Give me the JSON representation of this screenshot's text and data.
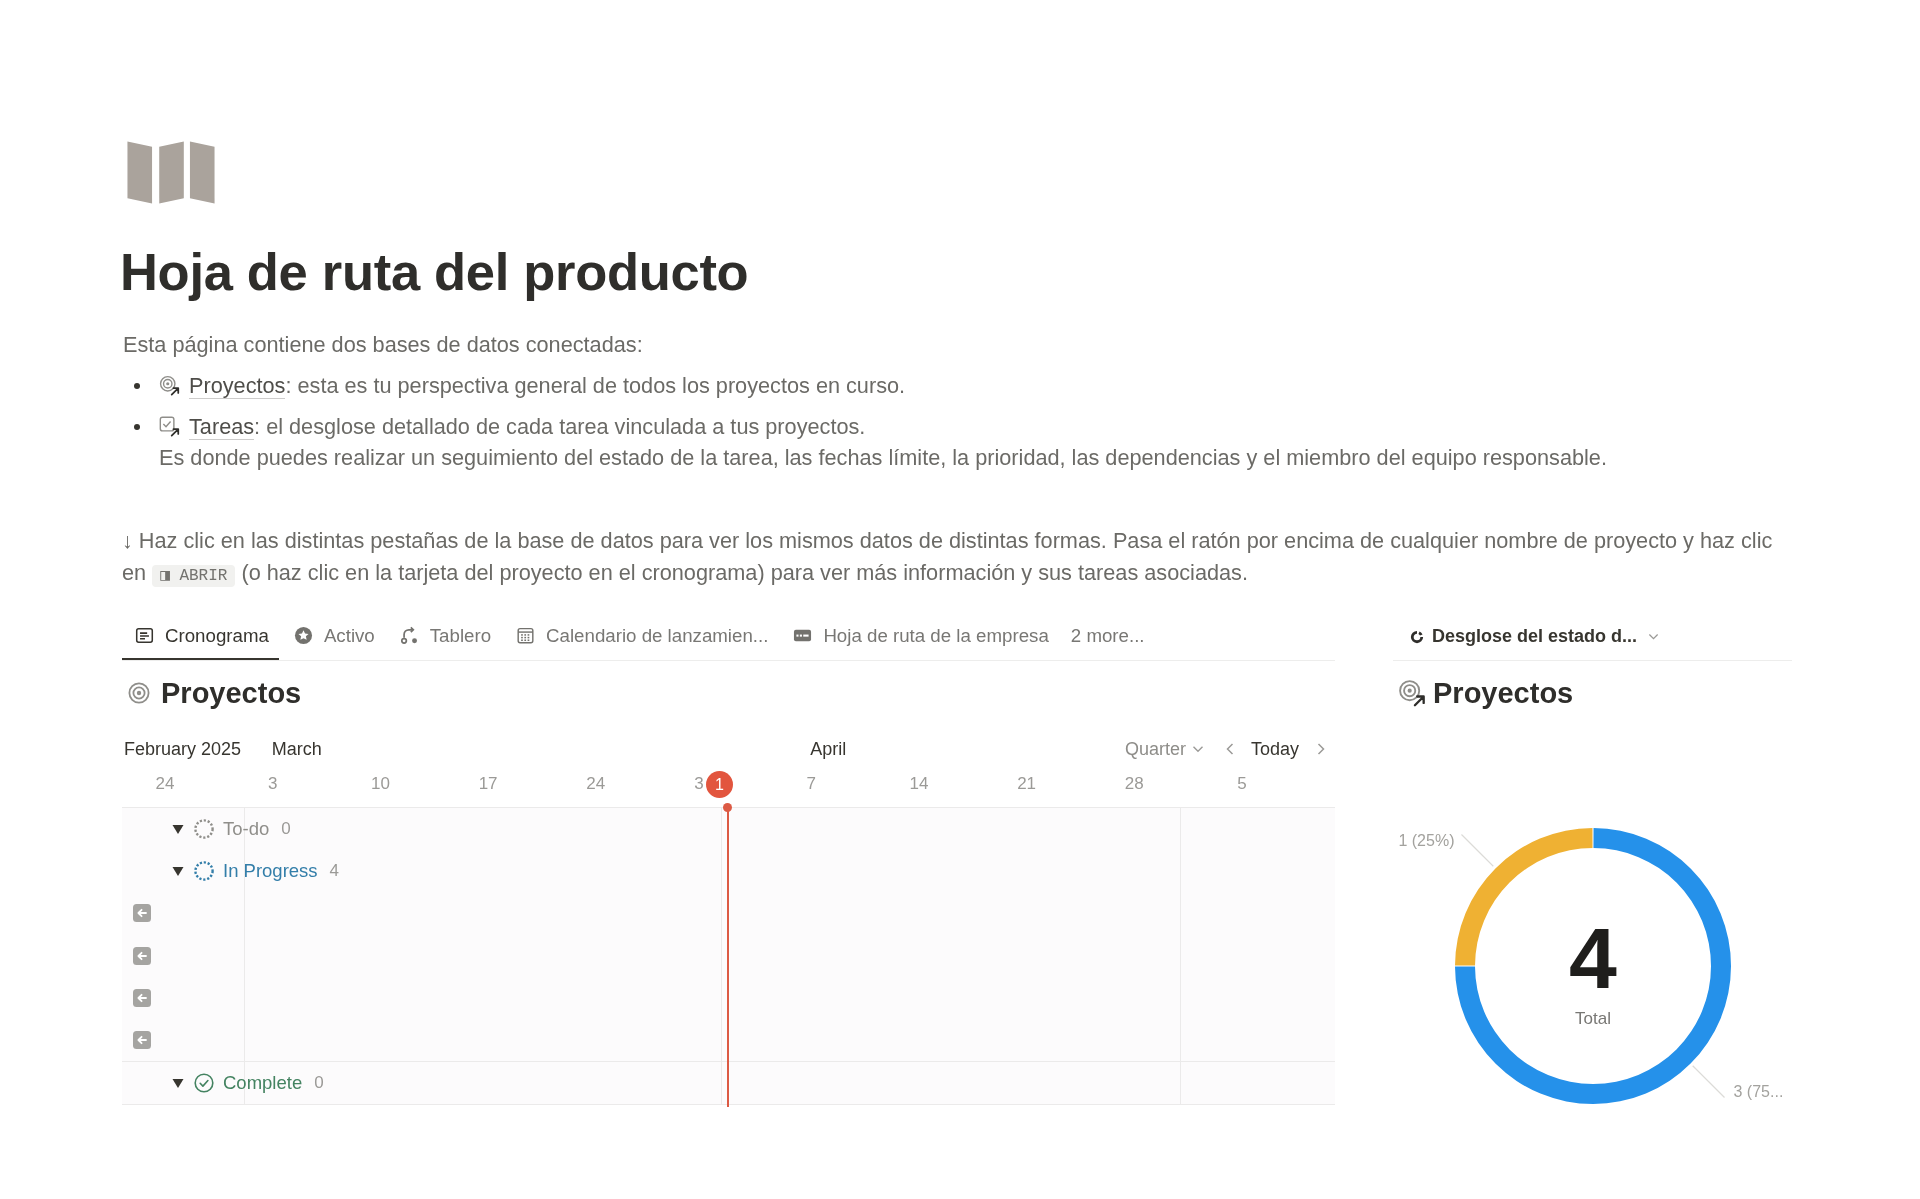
{
  "page": {
    "title": "Hoja de ruta del producto",
    "intro": "Esta página contiene dos bases de datos conectadas:",
    "bullets": [
      {
        "kind": "projects",
        "link": "Proyectos",
        "text": ": esta es tu perspectiva general de todos los proyectos en curso."
      },
      {
        "kind": "tasks",
        "link": "Tareas",
        "text": ": el desglose detallado de cada tarea vinculada a tus proyectos.",
        "continuation": "Es donde puedes realizar un seguimiento del estado de la tarea, las fechas límite, la prioridad, las dependencias y el miembro del equipo responsable."
      }
    ],
    "instruction": {
      "before": "↓ Haz clic en las distintas pestañas de la base de datos para ver los mismos datos de distintas formas. Pasa el ratón por encima de cualquier nombre de proyecto y haz clic en",
      "code": "◨ ABRIR",
      "after": "(o haz clic en la tarjeta del proyecto en el cronograma) para ver más información y sus tareas asociadas."
    }
  },
  "views": {
    "tabs": [
      {
        "label": "Cronograma",
        "kind": "timeline",
        "selected": true
      },
      {
        "label": "Activo",
        "kind": "star",
        "selected": false
      },
      {
        "label": "Tablero",
        "kind": "board",
        "selected": false
      },
      {
        "label": "Calendario de lanzamien...",
        "kind": "calendar",
        "selected": false
      },
      {
        "label": "Hoja de ruta de la empresa",
        "kind": "card",
        "selected": false
      }
    ],
    "more": "2 more...",
    "title": "Proyectos",
    "timeline": {
      "months": [
        "February 2025",
        "March",
        "April"
      ],
      "days": [
        "24",
        "3",
        "10",
        "17",
        "24",
        "3",
        "7",
        "14",
        "21",
        "28",
        "5"
      ],
      "today": "1",
      "zoom": "Quarter",
      "today_button": "Today",
      "groups": [
        {
          "label": "To-do",
          "count": "0",
          "kind": "todo",
          "color": "#8f8e8a",
          "expanded": true
        },
        {
          "label": "In Progress",
          "count": "4",
          "kind": "in_progress",
          "color": "#337ea9",
          "expanded": true,
          "rows": [
            {
              "kind": "offscreen_left"
            },
            {
              "kind": "offscreen_left"
            },
            {
              "kind": "offscreen_left"
            },
            {
              "kind": "offscreen_left"
            }
          ]
        },
        {
          "label": "Complete",
          "count": "0",
          "kind": "complete",
          "color": "#448361",
          "expanded": true
        }
      ]
    }
  },
  "chart_panel": {
    "view": "Desglose del estado d...",
    "title": "Proyectos",
    "total": "4",
    "total_label": "Total",
    "chart_data": {
      "type": "donut",
      "values": [
        3,
        1
      ],
      "colors": [
        "#2591ea",
        "#efb133"
      ],
      "value_labels": [
        "3 (75...",
        "1 (25%)"
      ]
    }
  }
}
